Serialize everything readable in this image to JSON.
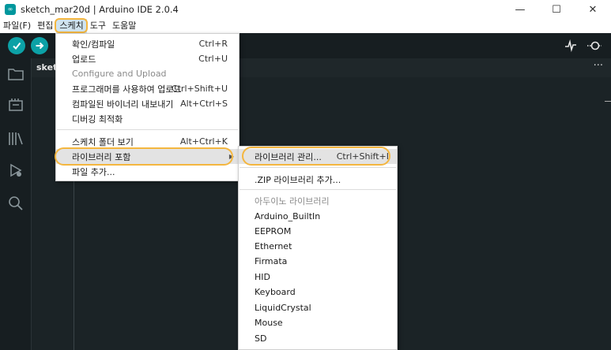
{
  "window": {
    "app_icon": "∞",
    "title": "sketch_mar20d | Arduino IDE 2.0.4",
    "minimize": "—",
    "maximize": "☐",
    "close": "✕"
  },
  "menubar": {
    "items": [
      "파일(F)",
      "편집",
      "스케치",
      "도구",
      "도움말"
    ]
  },
  "toolbar": {
    "verify_icon": "✓",
    "upload_icon": "→",
    "serial_plotter_icon": "∿",
    "serial_monitor_icon": "⚲"
  },
  "editor": {
    "tab_label": "sketc",
    "more": "···"
  },
  "sketch_menu": {
    "items": [
      {
        "label": "확인/컴파일",
        "shortcut": "Ctrl+R"
      },
      {
        "label": "업로드",
        "shortcut": "Ctrl+U"
      },
      {
        "label": "Configure and Upload",
        "shortcut": ""
      },
      {
        "label": "프로그래머를 사용하여 업로드",
        "shortcut": "Ctrl+Shift+U"
      },
      {
        "label": "컴파일된 바이너리 내보내기",
        "shortcut": "Alt+Ctrl+S"
      },
      {
        "label": "디버깅 최적화",
        "shortcut": ""
      },
      {
        "label": "스케치 폴더 보기",
        "shortcut": "Alt+Ctrl+K"
      },
      {
        "label": "라이브러리 포함",
        "shortcut": ""
      },
      {
        "label": "파일 추가...",
        "shortcut": ""
      }
    ]
  },
  "library_menu": {
    "manage": {
      "label": "라이브러리 관리...",
      "shortcut": "Ctrl+Shift+I"
    },
    "add_zip": ".ZIP 라이브러리 추가...",
    "header": "아두이노 라이브러리",
    "libraries": [
      "Arduino_BuiltIn",
      "EEPROM",
      "Ethernet",
      "Firmata",
      "HID",
      "Keyboard",
      "LiquidCrystal",
      "Mouse",
      "SD"
    ]
  },
  "colors": {
    "accent_teal": "#0ca1a6",
    "highlight_outline": "#f4b63f",
    "dark_bg": "#171e21"
  }
}
